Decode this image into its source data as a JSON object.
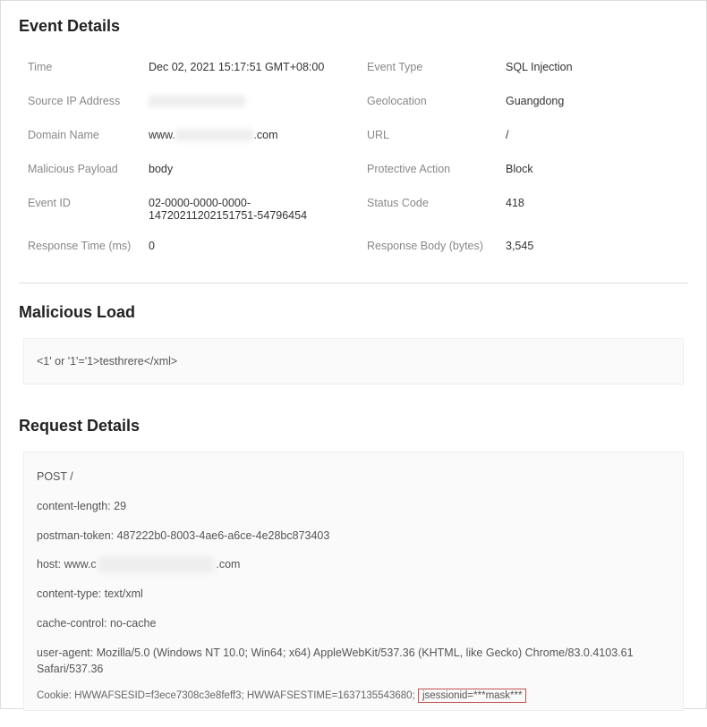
{
  "eventDetails": {
    "title": "Event Details",
    "leftCol": {
      "timeLabel": "Time",
      "timeValue": "Dec 02, 2021 15:17:51 GMT+08:00",
      "sourceIpLabel": "Source IP Address",
      "sourceIpValue": "",
      "domainLabel": "Domain Name",
      "domainPrefix": "www.",
      "domainSuffix": ".com",
      "payloadLabel": "Malicious Payload",
      "payloadValue": "body",
      "eventIdLabel": "Event ID",
      "eventIdValue": "02-0000-0000-0000-14720211202151751-54796454",
      "responseTimeLabel": "Response Time (ms)",
      "responseTimeValue": "0"
    },
    "rightCol": {
      "eventTypeLabel": "Event Type",
      "eventTypeValue": "SQL Injection",
      "geoLabel": "Geolocation",
      "geoValue": "Guangdong",
      "urlLabel": "URL",
      "urlValue": "/",
      "actionLabel": "Protective Action",
      "actionValue": "Block",
      "statusLabel": "Status Code",
      "statusValue": "418",
      "bodyLabel": "Response Body (bytes)",
      "bodyValue": "3,545"
    }
  },
  "maliciousLoad": {
    "title": "Malicious Load",
    "content": "<1' or '1'='1>testhrere</xml>"
  },
  "requestDetails": {
    "title": "Request Details",
    "line1": "POST /",
    "line2": "content-length: 29",
    "line3": "postman-token: 487222b0-8003-4ae6-a6ce-4e28bc873403",
    "line4Prefix": "host: www.c",
    "line4Suffix": ".com",
    "line5": "content-type: text/xml",
    "line6": "cache-control: no-cache",
    "line7": "user-agent: Mozilla/5.0 (Windows NT 10.0; Win64; x64) AppleWebKit/537.36 (KHTML, like Gecko) Chrome/83.0.4103.61 Safari/537.36",
    "cookiePrefix": "Cookie: HWWAFSESID=f3ece7308c3e8feff3; HWWAFSESTIME=1637135543680;",
    "cookieHighlight": "jsessionid=***mask***"
  }
}
